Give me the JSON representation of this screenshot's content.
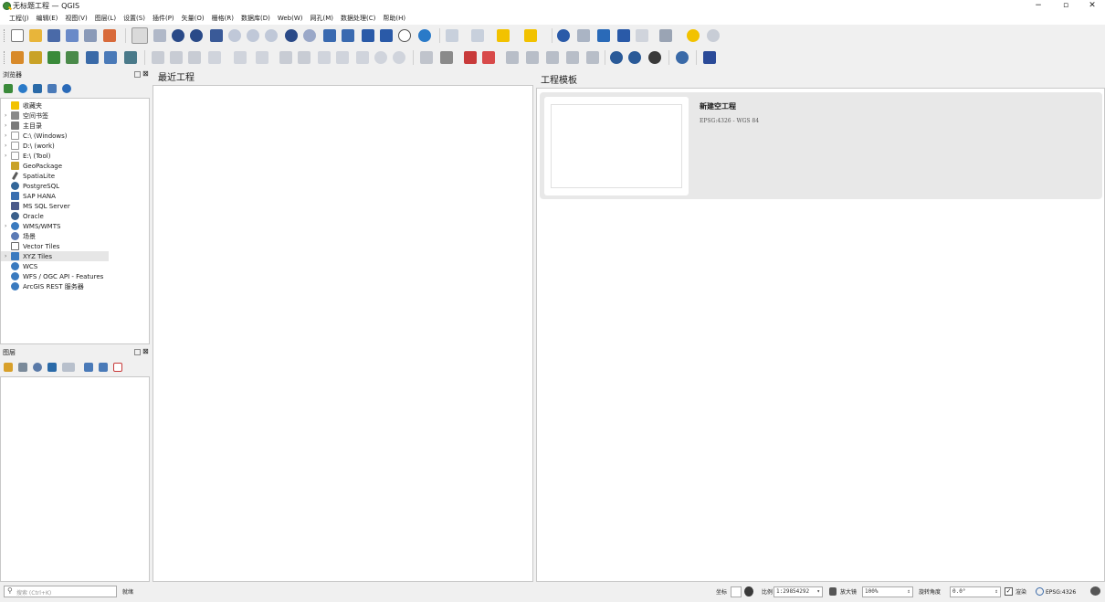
{
  "window": {
    "title": "无标题工程 — QGIS",
    "minimize": "−",
    "maximize": "▫",
    "close": "✕"
  },
  "menu": [
    "工程(J)",
    "编辑(E)",
    "视图(V)",
    "图层(L)",
    "设置(S)",
    "插件(P)",
    "矢量(O)",
    "栅格(R)",
    "数据库(D)",
    "Web(W)",
    "网孔(M)",
    "数据处理(C)",
    "帮助(H)"
  ],
  "browser": {
    "title": "浏览器",
    "items": [
      {
        "label": "收藏夹",
        "arrow": "",
        "icon": "star-icon",
        "color": "#f2c200"
      },
      {
        "label": "空间书签",
        "arrow": "›",
        "icon": "bookmark-icon",
        "color": "#8a8a8a"
      },
      {
        "label": "主目录",
        "arrow": "›",
        "icon": "home-icon",
        "color": "#7a7a7a"
      },
      {
        "label": "C:\\ (Windows)",
        "arrow": "›",
        "icon": "folder-icon",
        "color": "#9a9a9a"
      },
      {
        "label": "D:\\ (work)",
        "arrow": "›",
        "icon": "folder-icon",
        "color": "#9a9a9a"
      },
      {
        "label": "E:\\ (Tool)",
        "arrow": "›",
        "icon": "folder-icon",
        "color": "#9a9a9a"
      },
      {
        "label": "GeoPackage",
        "arrow": "",
        "icon": "geopackage-icon",
        "color": "#c9a227"
      },
      {
        "label": "SpatiaLite",
        "arrow": "",
        "icon": "spatialite-icon",
        "color": "#5a5a5a"
      },
      {
        "label": "PostgreSQL",
        "arrow": "",
        "icon": "postgresql-icon",
        "color": "#336699"
      },
      {
        "label": "SAP HANA",
        "arrow": "",
        "icon": "sap-hana-icon",
        "color": "#3a6fb0"
      },
      {
        "label": "MS SQL Server",
        "arrow": "",
        "icon": "mssql-icon",
        "color": "#4a5a8a"
      },
      {
        "label": "Oracle",
        "arrow": "",
        "icon": "oracle-icon",
        "color": "#3a5f8a"
      },
      {
        "label": "WMS/WMTS",
        "arrow": "›",
        "icon": "wms-icon",
        "color": "#3a7abf"
      },
      {
        "label": "场景",
        "arrow": "",
        "icon": "scene-icon",
        "color": "#5a7ab5"
      },
      {
        "label": "Vector Tiles",
        "arrow": "",
        "icon": "vector-tiles-icon",
        "color": "#6a6a6a"
      },
      {
        "label": "XYZ Tiles",
        "arrow": "›",
        "icon": "xyz-tiles-icon",
        "color": "#3a7abf"
      },
      {
        "label": "WCS",
        "arrow": "",
        "icon": "wcs-icon",
        "color": "#3a7abf"
      },
      {
        "label": "WFS / OGC API - Features",
        "arrow": "",
        "icon": "wfs-icon",
        "color": "#3a7abf"
      },
      {
        "label": "ArcGIS REST 服务器",
        "arrow": "",
        "icon": "arcgis-icon",
        "color": "#3a7abf"
      }
    ]
  },
  "layers": {
    "title": "图层"
  },
  "recent": {
    "title": "最近工程"
  },
  "templates": {
    "title": "工程模板",
    "card_title": "新建空工程",
    "card_crs": "EPSG:4326 - WGS 84"
  },
  "status": {
    "search_placeholder": "搜索 (Ctrl+K)",
    "ready": "就绪",
    "coord_label": "坐标",
    "scale_label": "比例",
    "scale_value": "1:29854292",
    "magnifier_label": "放大镜",
    "magnifier_value": "100%",
    "rotation_label": "旋转角度",
    "rotation_value": "0.0°",
    "render_label": "渲染",
    "crs": "EPSG:4326"
  }
}
